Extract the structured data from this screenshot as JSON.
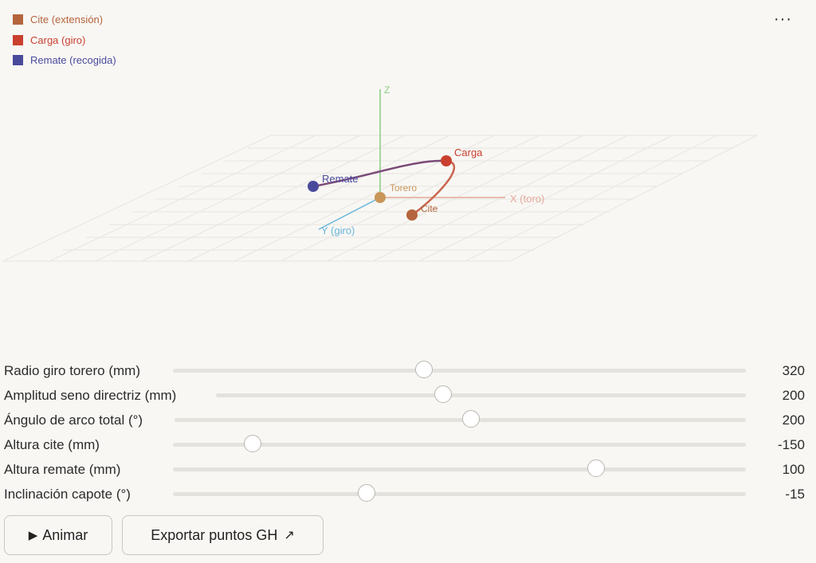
{
  "legend": {
    "items": [
      {
        "label": "Cite (extensión)",
        "color": "#b5653d"
      },
      {
        "label": "Carga (giro)",
        "color": "#c9402f"
      },
      {
        "label": "Remate (recogida)",
        "color": "#4a4a9c"
      }
    ]
  },
  "menu": {
    "icon": "more-horizontal-icon",
    "label": "···"
  },
  "scene": {
    "axes": {
      "x_label": "X (toro)",
      "x_color": "#e6a89a",
      "y_label": "Y (giro)",
      "y_color": "#6ab7dc",
      "z_label": "Z",
      "z_color": "#8ccc82"
    },
    "points": {
      "torero": {
        "label": "Torero",
        "color": "#c9965a"
      },
      "cite": {
        "label": "Cite",
        "color": "#b5653d"
      },
      "carga": {
        "label": "Carga",
        "color": "#c9402f"
      },
      "remate": {
        "label": "Remate",
        "color": "#4a4a9c"
      }
    }
  },
  "controls": [
    {
      "label": "Radio giro torero (mm)",
      "value": "320",
      "fraction": 0.44
    },
    {
      "label": "Amplitud seno directriz (mm)",
      "value": "200",
      "fraction": 0.43
    },
    {
      "label": "Ángulo de arco total (°)",
      "value": "200",
      "fraction": 0.52
    },
    {
      "label": "Altura cite (mm)",
      "value": "-150",
      "fraction": 0.14
    },
    {
      "label": "Altura remate (mm)",
      "value": "100",
      "fraction": 0.74
    },
    {
      "label": "Inclinación capote (°)",
      "value": "-15",
      "fraction": 0.34
    }
  ],
  "actions": {
    "animate": {
      "label": "Animar",
      "icon": "play-icon"
    },
    "export": {
      "label": "Exportar puntos GH",
      "icon": "external-arrow-icon"
    }
  }
}
